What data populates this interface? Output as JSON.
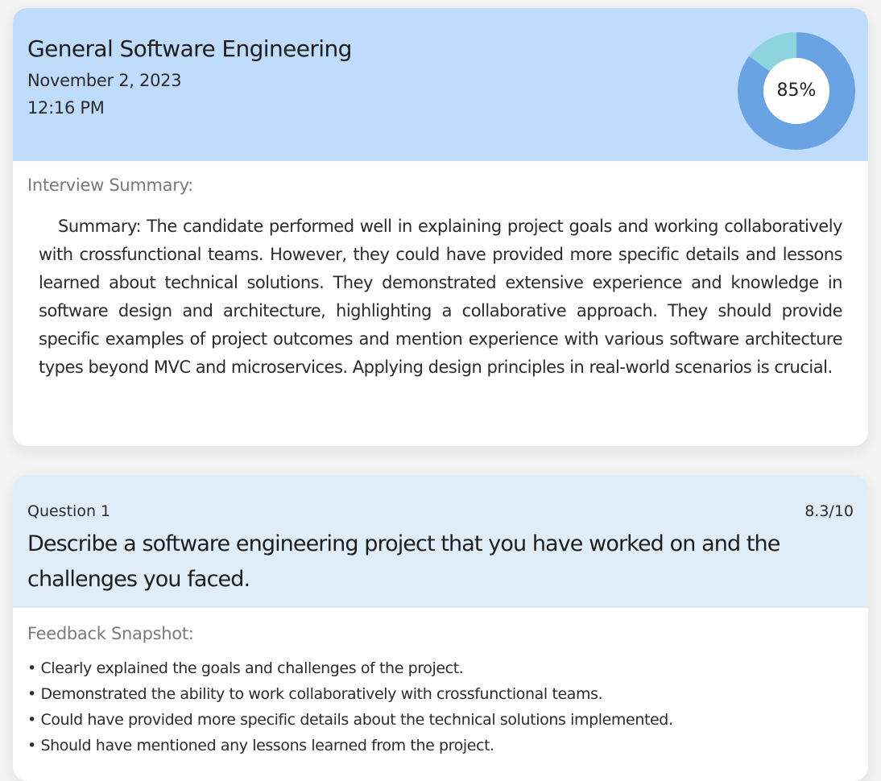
{
  "report": {
    "title": "General Software Engineering",
    "date": "November 2, 2023",
    "time": "12:16 PM",
    "score_label": "85%",
    "score_fraction": 0.85,
    "colors": {
      "donut_fill": "#6aa3e3",
      "donut_rest": "#8ed3de",
      "header_bg": "#bfdcfd"
    },
    "summary_label": "Interview Summary:",
    "summary_text": "Summary: The candidate performed well in explaining project goals and working collaboratively with crossfunctional teams. However, they could have provided more specific details and lessons learned about technical solutions. They demonstrated extensive experience and knowledge in software design and architecture, highlighting a collaborative approach. They should provide specific examples of project outcomes and mention experience with various software architecture types beyond MVC and microservices. Applying design principles in real-world scenarios is crucial."
  },
  "question": {
    "number_label": "Question 1",
    "score": "8.3/10",
    "text": "Describe a software engineering project that you have worked on and the challenges you faced.",
    "feedback_label": "Feedback Snapshot:",
    "feedback": [
      "Clearly explained the goals and challenges of the project.",
      "Demonstrated the ability to work collaboratively with crossfunctional teams.",
      "Could have provided more specific details about the technical solutions implemented.",
      "Should have mentioned any lessons learned from the project."
    ]
  }
}
